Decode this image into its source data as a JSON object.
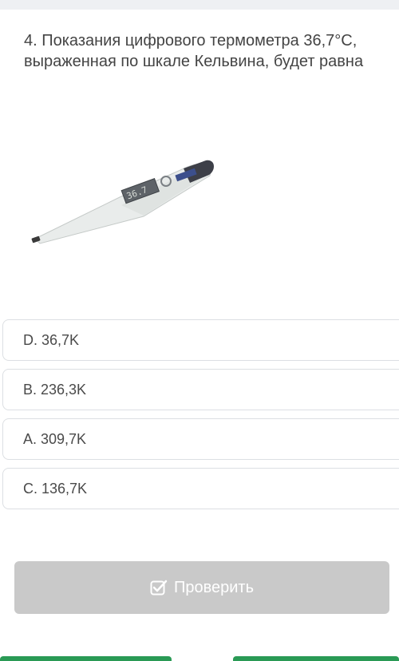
{
  "question": {
    "text": "4. Показания цифрового термометра 36,7°C, выраженная по шкале Кельвина, будет равна"
  },
  "thermometer": {
    "display_reading": "36.7"
  },
  "options": [
    {
      "label": "D. 36,7K"
    },
    {
      "label": "B. 236,3K"
    },
    {
      "label": "A. 309,7K"
    },
    {
      "label": "C. 136,7K"
    }
  ],
  "actions": {
    "check_label": "Проверить",
    "check_icon": "checkbox-check-icon"
  },
  "colors": {
    "check_button_bg": "#c9c9c9",
    "bottom_button_bg": "#2a9a55"
  }
}
